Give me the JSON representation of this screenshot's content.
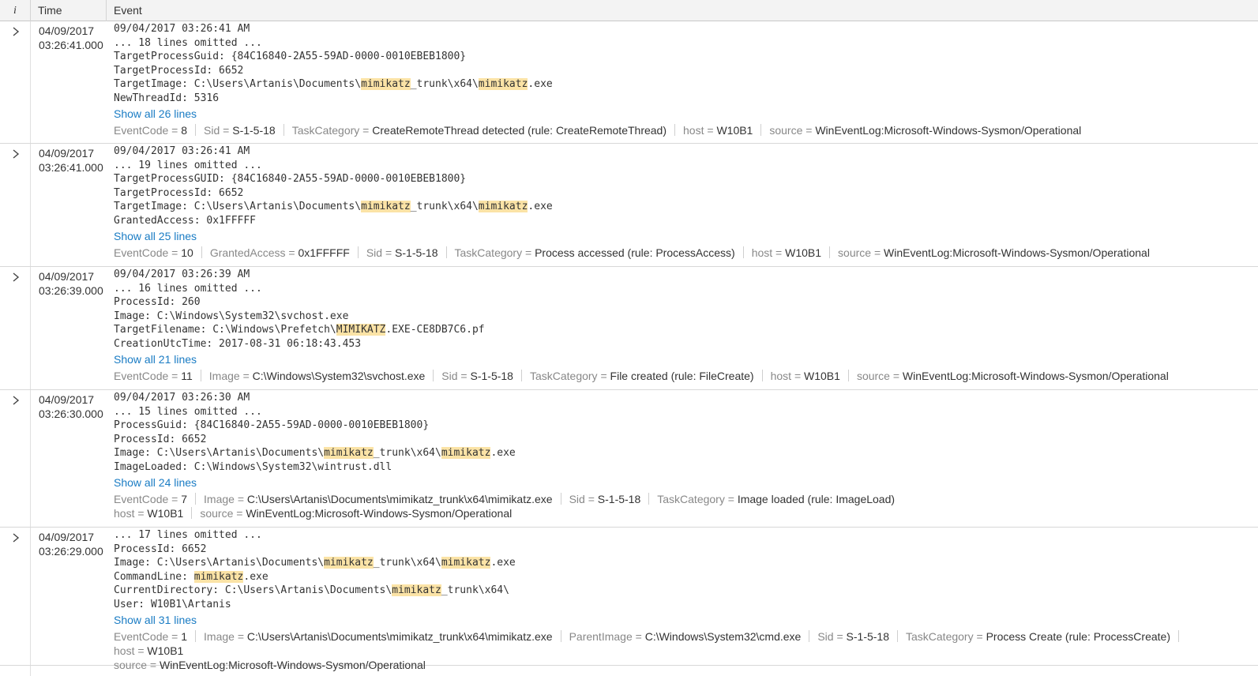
{
  "columns": {
    "info": "i",
    "time": "Time",
    "event": "Event"
  },
  "eq": "=",
  "events": [
    {
      "date": "04/09/2017",
      "time": "03:26:41.000",
      "lines": [
        [
          {
            "t": "09/04/2017 03:26:41 AM"
          }
        ],
        [
          {
            "t": "... 18 lines omitted ..."
          }
        ],
        [
          {
            "t": "TargetProcessGuid: {84C16840-2A55-59AD-0000-0010EBEB1800}"
          }
        ],
        [
          {
            "t": "TargetProcessId: 6652"
          }
        ],
        [
          {
            "t": "TargetImage: C:\\Users\\Artanis\\Documents\\"
          },
          {
            "t": "mimikatz",
            "h": true
          },
          {
            "t": "_trunk\\x64\\"
          },
          {
            "t": "mimikatz",
            "h": true
          },
          {
            "t": ".exe"
          }
        ],
        [
          {
            "t": "NewThreadId: 5316"
          }
        ]
      ],
      "show_all": "Show all 26 lines",
      "fields": [
        {
          "k": "EventCode",
          "v": "8"
        },
        {
          "k": "Sid",
          "v": "S-1-5-18"
        },
        {
          "k": "TaskCategory",
          "v": "CreateRemoteThread detected (rule: CreateRemoteThread)"
        },
        {
          "k": "host",
          "v": "W10B1"
        },
        {
          "k": "source",
          "v": "WinEventLog:Microsoft-Windows-Sysmon/Operational"
        }
      ]
    },
    {
      "date": "04/09/2017",
      "time": "03:26:41.000",
      "lines": [
        [
          {
            "t": "09/04/2017 03:26:41 AM"
          }
        ],
        [
          {
            "t": "... 19 lines omitted ..."
          }
        ],
        [
          {
            "t": "TargetProcessGUID: {84C16840-2A55-59AD-0000-0010EBEB1800}"
          }
        ],
        [
          {
            "t": "TargetProcessId: 6652"
          }
        ],
        [
          {
            "t": "TargetImage: C:\\Users\\Artanis\\Documents\\"
          },
          {
            "t": "mimikatz",
            "h": true
          },
          {
            "t": "_trunk\\x64\\"
          },
          {
            "t": "mimikatz",
            "h": true
          },
          {
            "t": ".exe"
          }
        ],
        [
          {
            "t": "GrantedAccess: 0x1FFFFF"
          }
        ]
      ],
      "show_all": "Show all 25 lines",
      "fields": [
        {
          "k": "EventCode",
          "v": "10"
        },
        {
          "k": "GrantedAccess",
          "v": "0x1FFFFF"
        },
        {
          "k": "Sid",
          "v": "S-1-5-18"
        },
        {
          "k": "TaskCategory",
          "v": "Process accessed (rule: ProcessAccess)"
        },
        {
          "k": "host",
          "v": "W10B1"
        },
        {
          "k": "source",
          "v": "WinEventLog:Microsoft-Windows-Sysmon/Operational"
        }
      ]
    },
    {
      "date": "04/09/2017",
      "time": "03:26:39.000",
      "lines": [
        [
          {
            "t": "09/04/2017 03:26:39 AM"
          }
        ],
        [
          {
            "t": "... 16 lines omitted ..."
          }
        ],
        [
          {
            "t": "ProcessId: 260"
          }
        ],
        [
          {
            "t": "Image: C:\\Windows\\System32\\svchost.exe"
          }
        ],
        [
          {
            "t": "TargetFilename: C:\\Windows\\Prefetch\\"
          },
          {
            "t": "MIMIKATZ",
            "h": true
          },
          {
            "t": ".EXE-CE8DB7C6.pf"
          }
        ],
        [
          {
            "t": "CreationUtcTime: 2017-08-31 06:18:43.453"
          }
        ]
      ],
      "show_all": "Show all 21 lines",
      "fields": [
        {
          "k": "EventCode",
          "v": "11"
        },
        {
          "k": "Image",
          "v": "C:\\Windows\\System32\\svchost.exe"
        },
        {
          "k": "Sid",
          "v": "S-1-5-18"
        },
        {
          "k": "TaskCategory",
          "v": "File created (rule: FileCreate)"
        },
        {
          "k": "host",
          "v": "W10B1"
        },
        {
          "k": "source",
          "v": "WinEventLog:Microsoft-Windows-Sysmon/Operational"
        }
      ]
    },
    {
      "date": "04/09/2017",
      "time": "03:26:30.000",
      "lines": [
        [
          {
            "t": "09/04/2017 03:26:30 AM"
          }
        ],
        [
          {
            "t": "... 15 lines omitted ..."
          }
        ],
        [
          {
            "t": "ProcessGuid: {84C16840-2A55-59AD-0000-0010EBEB1800}"
          }
        ],
        [
          {
            "t": "ProcessId: 6652"
          }
        ],
        [
          {
            "t": "Image: C:\\Users\\Artanis\\Documents\\"
          },
          {
            "t": "mimikatz",
            "h": true
          },
          {
            "t": "_trunk\\x64\\"
          },
          {
            "t": "mimikatz",
            "h": true
          },
          {
            "t": ".exe"
          }
        ],
        [
          {
            "t": "ImageLoaded: C:\\Windows\\System32\\wintrust.dll"
          }
        ]
      ],
      "show_all": "Show all 24 lines",
      "fields": [
        {
          "k": "EventCode",
          "v": "7"
        },
        {
          "k": "Image",
          "v": "C:\\Users\\Artanis\\Documents\\mimikatz_trunk\\x64\\mimikatz.exe"
        },
        {
          "k": "Sid",
          "v": "S-1-5-18"
        },
        {
          "k": "TaskCategory",
          "v": "Image loaded (rule: ImageLoad)"
        },
        {
          "k": "host",
          "v": "W10B1"
        },
        {
          "k": "source",
          "v": "WinEventLog:Microsoft-Windows-Sysmon/Operational"
        }
      ]
    },
    {
      "date": "04/09/2017",
      "time": "03:26:29.000",
      "lines": [
        [
          {
            "t": "... 17 lines omitted ..."
          }
        ],
        [
          {
            "t": "ProcessId: 6652"
          }
        ],
        [
          {
            "t": "Image: C:\\Users\\Artanis\\Documents\\"
          },
          {
            "t": "mimikatz",
            "h": true
          },
          {
            "t": "_trunk\\x64\\"
          },
          {
            "t": "mimikatz",
            "h": true
          },
          {
            "t": ".exe"
          }
        ],
        [
          {
            "t": "CommandLine: "
          },
          {
            "t": "mimikatz",
            "h": true
          },
          {
            "t": ".exe"
          }
        ],
        [
          {
            "t": "CurrentDirectory: C:\\Users\\Artanis\\Documents\\"
          },
          {
            "t": "mimikatz",
            "h": true
          },
          {
            "t": "_trunk\\x64\\"
          }
        ],
        [
          {
            "t": "User: W10B1\\Artanis"
          }
        ]
      ],
      "show_all": "Show all 31 lines",
      "fields": [
        {
          "k": "EventCode",
          "v": "1"
        },
        {
          "k": "Image",
          "v": "C:\\Users\\Artanis\\Documents\\mimikatz_trunk\\x64\\mimikatz.exe"
        },
        {
          "k": "ParentImage",
          "v": "C:\\Windows\\System32\\cmd.exe"
        },
        {
          "k": "Sid",
          "v": "S-1-5-18"
        },
        {
          "k": "TaskCategory",
          "v": "Process Create (rule: ProcessCreate)"
        },
        {
          "k": "host",
          "v": "W10B1"
        },
        {
          "k": "source",
          "v": "WinEventLog:Microsoft-Windows-Sysmon/Operational"
        }
      ]
    }
  ]
}
